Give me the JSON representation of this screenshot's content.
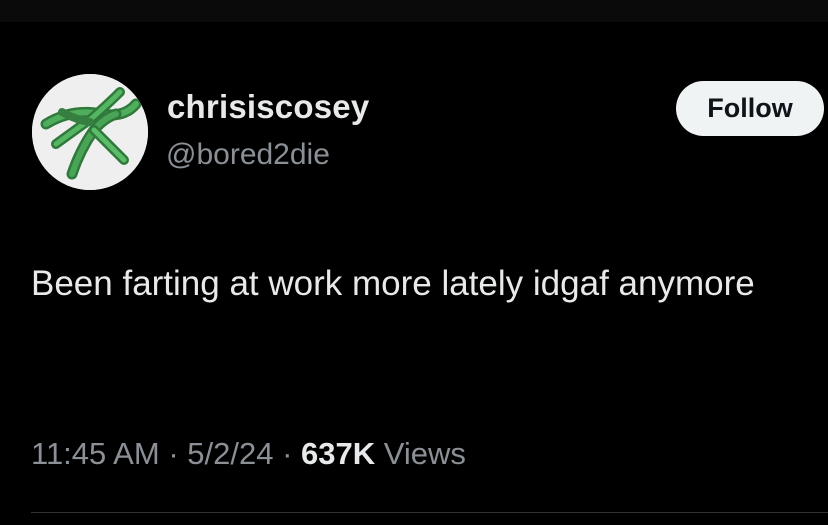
{
  "user": {
    "display_name": "chrisiscosey",
    "handle": "@bored2die",
    "avatar_icon": "green-hair-clip-avatar"
  },
  "follow_label": "Follow",
  "tweet": {
    "text": "Been farting at work more lately idgaf anymore"
  },
  "meta": {
    "time": "11:45 AM",
    "separator": "·",
    "date": "5/2/24",
    "views_count": "637K",
    "views_label": "Views"
  },
  "colors": {
    "background": "#000000",
    "primary_text": "#e7e9ea",
    "secondary_text": "#8b9096",
    "follow_bg": "#eff3f4",
    "follow_text": "#0f1419",
    "avatar_accent": "#3f9a4e"
  }
}
